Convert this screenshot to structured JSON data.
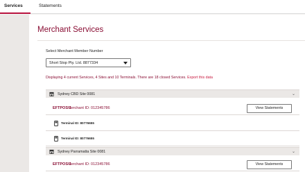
{
  "tabs": {
    "services": "Services",
    "statements": "Statements"
  },
  "page": {
    "title": "Merchant Services",
    "select_label": "Select Merchant Member Number",
    "selected_member": "Short Stop Pty. Ltd.  8877334",
    "summary_text": "Displaying 4 current Services, 4 Sites and 10 Terminals. There are 18 closed Services.",
    "export_link": "Export this data"
  },
  "sites": [
    {
      "name": "Sydney CBD Site 0081",
      "eftpos_label": "EFTPOS 1",
      "merchant_id": "Merchant ID: 012345786",
      "view_button": "View Statements",
      "terminals": [
        "Terminal ID: 80776655",
        "Terminal ID: 80776655"
      ]
    },
    {
      "name": "Sydney Parramatta Site 0081",
      "eftpos_label": "EFTPOS 1",
      "merchant_id": "Merchant ID: 012345786",
      "view_button": "View Statements"
    }
  ],
  "icons": {
    "store": "store-icon",
    "terminal": "pos-terminal-icon",
    "expand": "chevron-down-icon"
  },
  "colors": {
    "brand": "#8a0e34",
    "accent": "#b8123e",
    "background": "#f2f0ef"
  }
}
